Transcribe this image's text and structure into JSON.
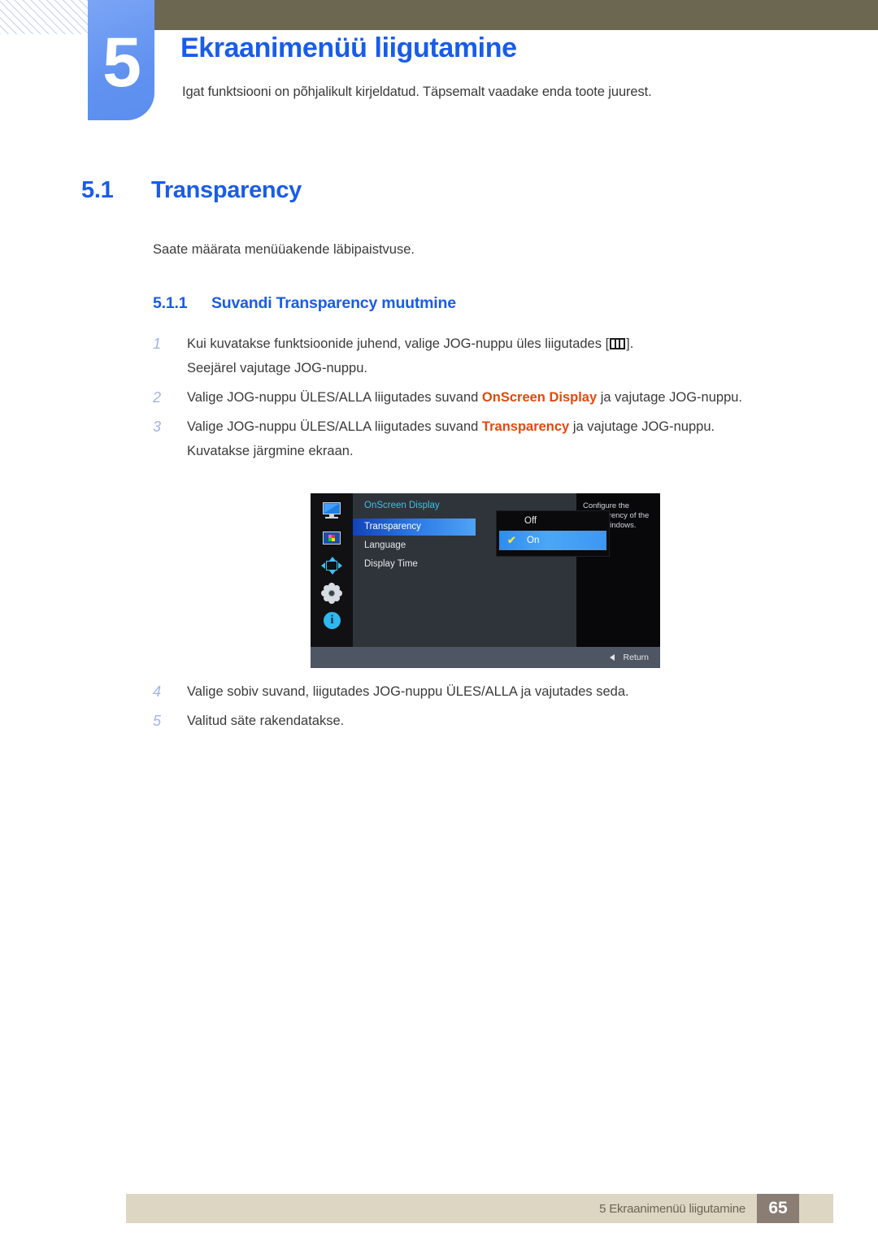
{
  "header": {
    "chapter_number": "5",
    "chapter_title": "Ekraanimenüü liigutamine",
    "chapter_subtitle": "Igat funktsiooni on põhjalikult kirjeldatud. Täpsemalt vaadake enda toote juurest.",
    "banner_color": "#6b6750",
    "tab_color": "#6192f0"
  },
  "section": {
    "number": "5.1",
    "title": "Transparency",
    "paragraph": "Saate määrata menüüakende läbipaistvuse.",
    "sub_number": "5.1.1",
    "sub_title": "Suvandi Transparency muutmine",
    "heading_color": "#1a5ce8"
  },
  "steps": {
    "step1_num": "1",
    "step1_pre": "Kui kuvatakse funktsioonide juhend, valige JOG-nuppu üles liigutades [",
    "step1_post": "].",
    "step1_cont": "Seejärel vajutage JOG-nuppu.",
    "step2_num": "2",
    "step2_pre": "Valige JOG-nuppu ÜLES/ALLA liigutades suvand ",
    "step2_hl": "OnScreen Display",
    "step2_post": " ja vajutage JOG-nuppu.",
    "step3_num": "3",
    "step3_pre": "Valige JOG-nuppu ÜLES/ALLA liigutades suvand ",
    "step3_hl": "Transparency",
    "step3_post": " ja vajutage JOG-nuppu.",
    "step3_cont": "Kuvatakse järgmine ekraan.",
    "step4_num": "4",
    "step4_text": "Valige sobiv suvand, liigutades JOG-nuppu ÜLES/ALLA ja vajutades seda.",
    "step5_num": "5",
    "step5_text": "Valitud säte rakendatakse.",
    "highlight_color": "#e04a12",
    "number_color": "#9fb4ee"
  },
  "osd": {
    "title": "OnScreen Display",
    "title_color": "#38c2ef",
    "sidebar_icons": [
      "monitor-icon",
      "picture-color-icon",
      "position-arrows-icon",
      "gear-settings-icon",
      "info-icon"
    ],
    "menu_items": [
      {
        "label": "Transparency",
        "selected": true
      },
      {
        "label": "Language",
        "selected": false
      },
      {
        "label": "Display Time",
        "selected": false
      }
    ],
    "options": [
      {
        "label": "Off",
        "selected": false,
        "checked": false
      },
      {
        "label": "On",
        "selected": true,
        "checked": true
      }
    ],
    "check_glyph": "✔",
    "description": "Configure the transparency of the menu windows.",
    "return_label": "Return",
    "highlight_color": "#2f7de8"
  },
  "footer": {
    "text": "5 Ekraanimenüü liigutamine",
    "page": "65",
    "bar_color": "#ddd6c3",
    "page_box_color": "#8a7d73"
  }
}
